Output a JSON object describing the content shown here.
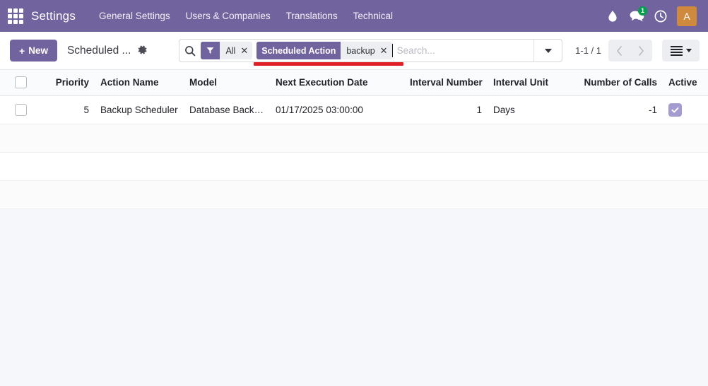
{
  "navbar": {
    "apps_icon": "apps-grid-icon",
    "brand": "Settings",
    "menu": [
      {
        "label": "General Settings"
      },
      {
        "label": "Users & Companies"
      },
      {
        "label": "Translations"
      },
      {
        "label": "Technical"
      }
    ],
    "right_icons": [
      {
        "name": "activity-drop-icon",
        "glyph": "●"
      },
      {
        "name": "messages-icon",
        "glyph": "●",
        "badge": "1"
      },
      {
        "name": "clock-icon",
        "glyph": "●"
      }
    ],
    "avatar_initial": "A",
    "bg_color": "#71639e",
    "avatar_color": "#d08a3e",
    "badge_color": "#00a04a",
    "badge_count": "1"
  },
  "control_panel": {
    "new_button": "New",
    "new_button_plus": "+",
    "breadcrumb": "Scheduled ...",
    "gear_icon": "gear-icon",
    "search": {
      "search_icon": "search-icon",
      "placeholder": "Search...",
      "value": "",
      "facets": [
        {
          "head_icon": "filter-funnel-icon",
          "head": "",
          "body": "All",
          "remove": "✕"
        },
        {
          "head_icon": "",
          "head": "Scheduled Action",
          "body": "backup",
          "remove": "✕"
        }
      ],
      "toggle_icon": "chevron-down-icon",
      "underline_color": "#e01f26"
    },
    "pager": {
      "count": "1-1 / 1",
      "previous_icon": "chevron-left-icon",
      "next_icon": "chevron-right-icon"
    },
    "view_switcher": {
      "icon": "list-view-icon",
      "caret": "chevron-down-icon"
    }
  },
  "list": {
    "columns": [
      {
        "key": "select",
        "label": "",
        "align": "center"
      },
      {
        "key": "priority",
        "label": "Priority",
        "align": "right"
      },
      {
        "key": "action",
        "label": "Action Name",
        "align": "left"
      },
      {
        "key": "model",
        "label": "Model",
        "align": "left"
      },
      {
        "key": "next",
        "label": "Next Execution Date",
        "align": "left"
      },
      {
        "key": "inum",
        "label": "Interval Number",
        "align": "right"
      },
      {
        "key": "iunit",
        "label": "Interval Unit",
        "align": "left"
      },
      {
        "key": "noc",
        "label": "Number of Calls",
        "align": "right"
      },
      {
        "key": "active",
        "label": "Active",
        "align": "center"
      }
    ],
    "rows": [
      {
        "priority": "5",
        "action": "Backup Scheduler",
        "model": "Database Backup",
        "next": "01/17/2025 03:00:00",
        "inum": "1",
        "iunit": "Days",
        "noc": "-1",
        "active": true
      }
    ],
    "filler_rows": 3,
    "checkbox_checked_color": "#a49cd0"
  }
}
